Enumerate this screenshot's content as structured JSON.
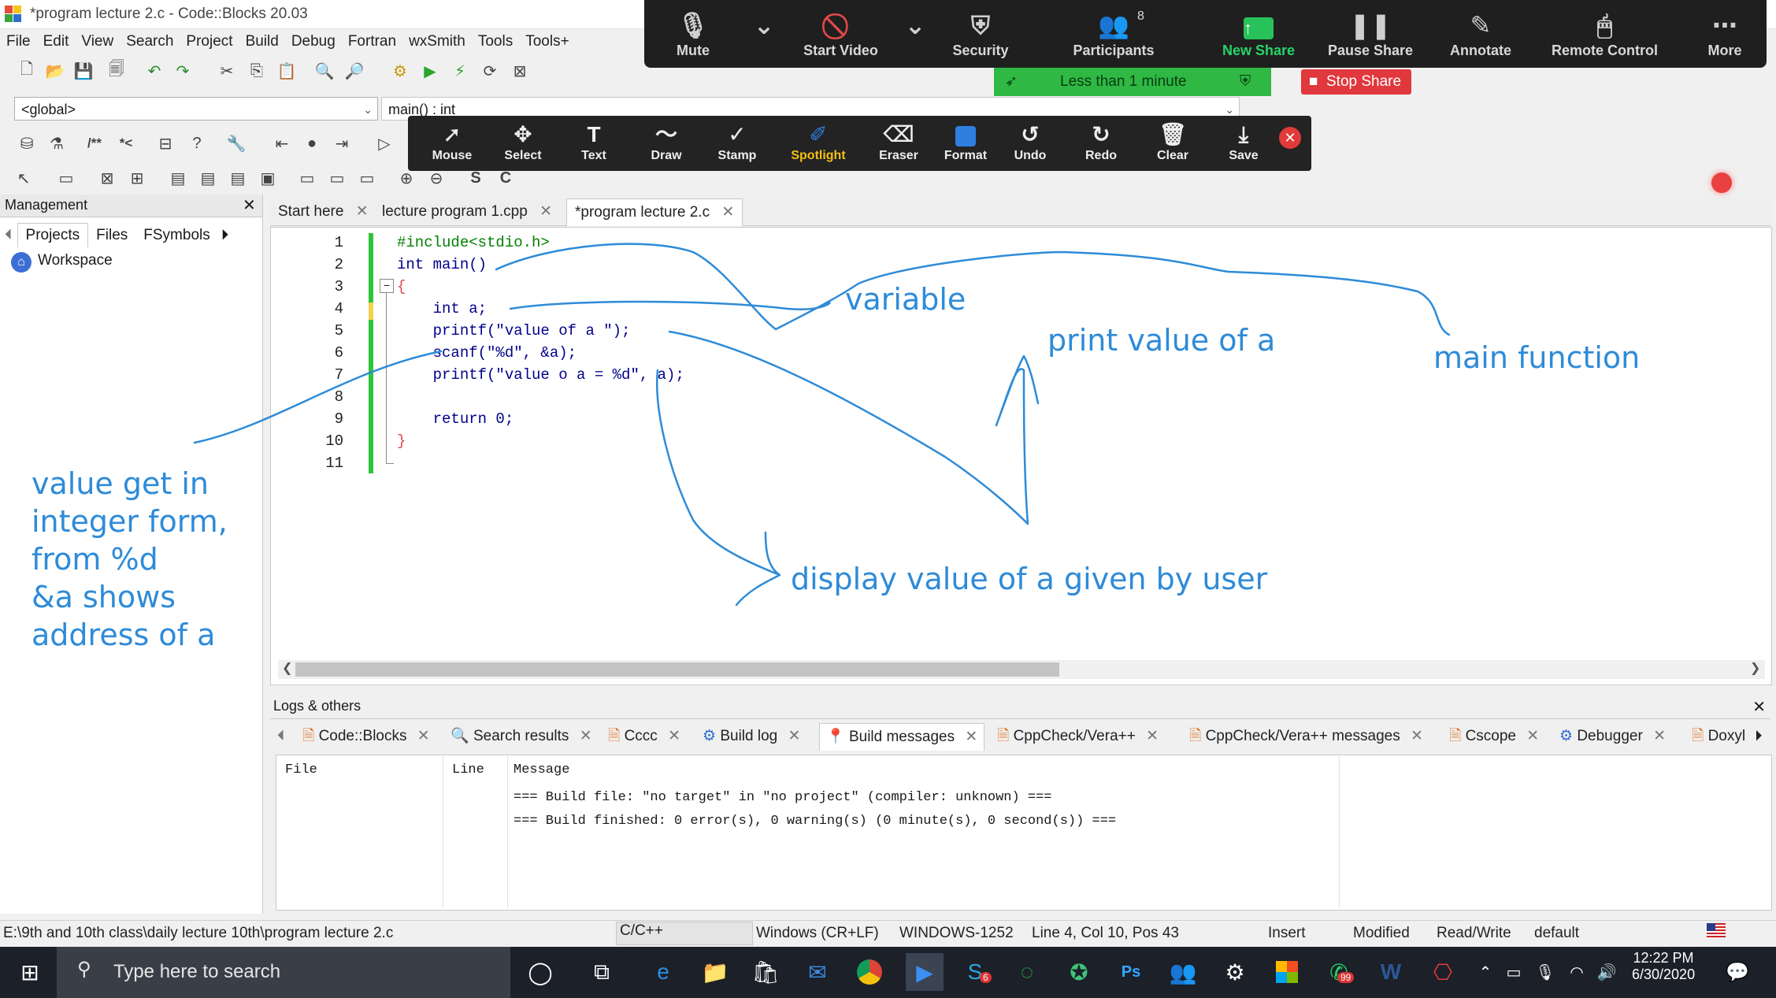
{
  "window": {
    "title": "*program lecture 2.c - Code::Blocks 20.03"
  },
  "menu": [
    "File",
    "Edit",
    "View",
    "Search",
    "Project",
    "Build",
    "Debug",
    "Fortran",
    "wxSmith",
    "Tools",
    "Tools+"
  ],
  "combos": {
    "scope": "<global>",
    "function": "main() : int"
  },
  "zoom": {
    "buttons": [
      "Mute",
      "Start Video",
      "Security",
      "Participants",
      "New Share",
      "Pause Share",
      "Annotate",
      "Remote Control",
      "More"
    ],
    "participants_count": "8",
    "share_status": "Less than 1 minute",
    "stop_share": "Stop Share"
  },
  "annotate_toolbar": [
    "Mouse",
    "Select",
    "Text",
    "Draw",
    "Stamp",
    "Spotlight",
    "Eraser",
    "Format",
    "Undo",
    "Redo",
    "Clear",
    "Save"
  ],
  "management": {
    "title": "Management",
    "tabs": [
      "Projects",
      "Files",
      "FSymbols"
    ],
    "workspace": "Workspace"
  },
  "editor": {
    "tabs": [
      "Start here",
      "lecture program 1.cpp",
      "*program lecture 2.c"
    ],
    "lines": [
      {
        "n": "1",
        "code": "#include<stdio.h>"
      },
      {
        "n": "2",
        "code": "int main()"
      },
      {
        "n": "3",
        "code": "{"
      },
      {
        "n": "4",
        "code": "    int a;"
      },
      {
        "n": "5",
        "code": "    printf(\"value of a \");"
      },
      {
        "n": "6",
        "code": "    scanf(\"%d\", &a);"
      },
      {
        "n": "7",
        "code": "    printf(\"value o a = %d\", a);"
      },
      {
        "n": "8",
        "code": ""
      },
      {
        "n": "9",
        "code": "    return 0;"
      },
      {
        "n": "10",
        "code": "}"
      },
      {
        "n": "11",
        "code": ""
      }
    ]
  },
  "annotations": {
    "variable": "variable",
    "print": "print value of a",
    "main": "main function",
    "display": "display value of a given by user",
    "value_lines": [
      "value get in",
      "integer form,",
      "from %d",
      "&a shows",
      "address of a"
    ]
  },
  "logs": {
    "title": "Logs & others",
    "tabs": [
      "Code::Blocks",
      "Search results",
      "Cccc",
      "Build log",
      "Build messages",
      "CppCheck/Vera++",
      "CppCheck/Vera++ messages",
      "Cscope",
      "Debugger",
      "Doxyl"
    ],
    "columns": [
      "File",
      "Line",
      "Message"
    ],
    "messages": [
      "=== Build file: \"no target\" in \"no project\" (compiler: unknown) ===",
      "=== Build finished: 0 error(s), 0 warning(s) (0 minute(s), 0 second(s)) ==="
    ]
  },
  "statusbar": {
    "path": "E:\\9th and 10th class\\daily lecture 10th\\program lecture 2.c",
    "lang": "C/C++",
    "eol": "Windows (CR+LF)",
    "encoding": "WINDOWS-1252",
    "position": "Line 4, Col 10, Pos 43",
    "mode": "Insert",
    "modified": "Modified",
    "access": "Read/Write",
    "profile": "default"
  },
  "taskbar": {
    "search_placeholder": "Type here to search",
    "time": "12:22 PM",
    "date": "6/30/2020",
    "skype_badge": "6",
    "whatsapp_badge": "99"
  },
  "colors": {
    "annotation": "#2e8bd8",
    "zoom_green": "#2fb844",
    "stop_red": "#e0383d"
  }
}
